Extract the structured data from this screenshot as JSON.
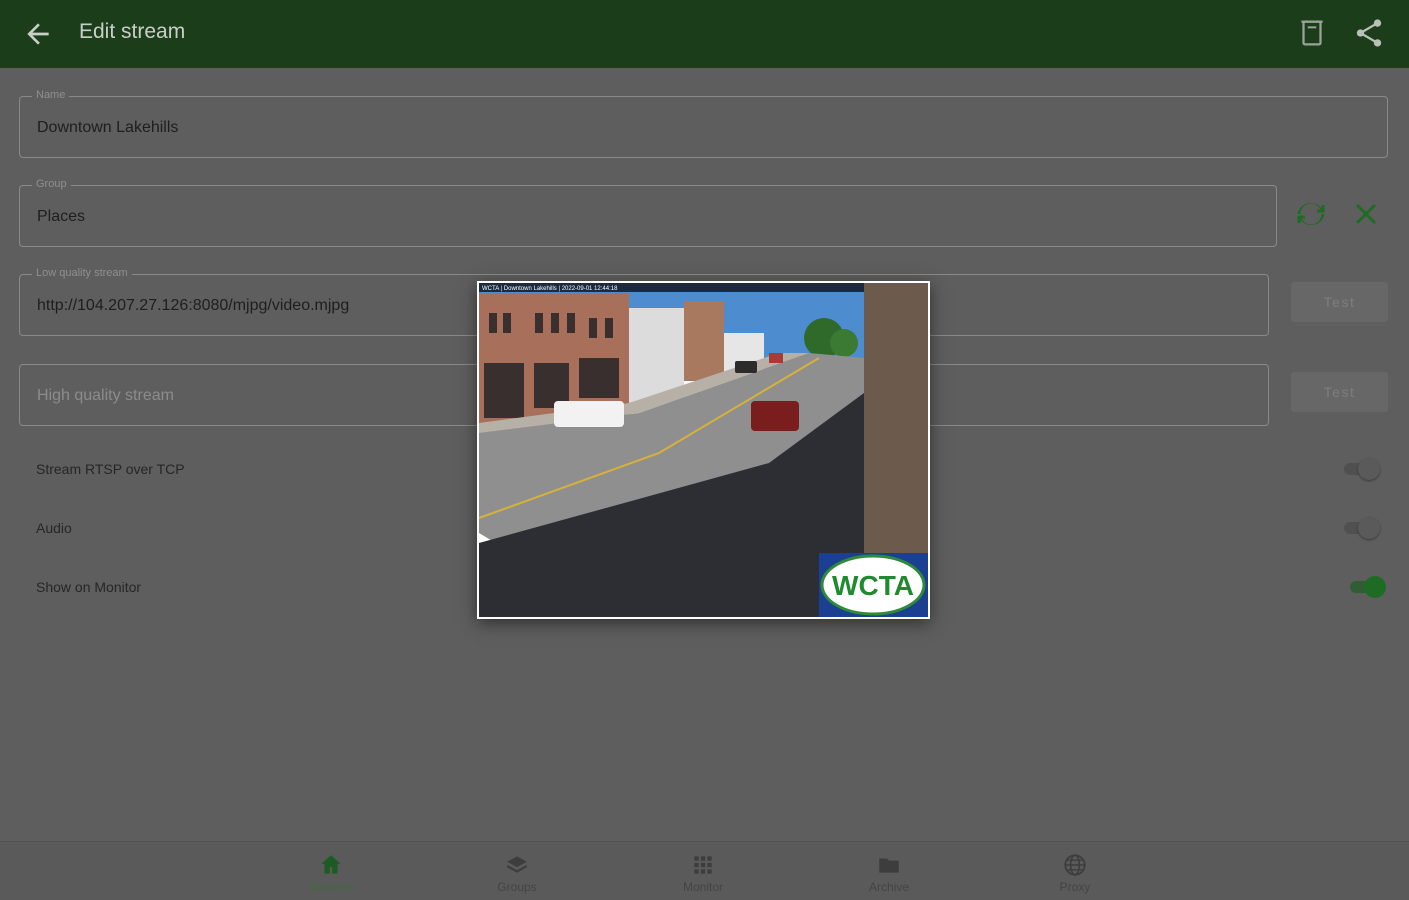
{
  "appbar": {
    "title": "Edit stream",
    "icons": [
      "arrow-back-icon",
      "delete-icon",
      "share-icon"
    ]
  },
  "form": {
    "name": {
      "label": "Name",
      "value": "Downtown Lakehills"
    },
    "group": {
      "label": "Group",
      "value": "Places"
    },
    "low_quality": {
      "label": "Low quality stream",
      "value": "http://104.207.27.126:8080/mjpg/video.mjpg"
    },
    "high_quality": {
      "placeholder": "High quality stream"
    },
    "test_label": "Test"
  },
  "settings": {
    "rtsp_tcp": {
      "label": "Stream RTSP over TCP",
      "on": false
    },
    "audio": {
      "label": "Audio",
      "on": false
    },
    "show_monitor": {
      "label": "Show on Monitor",
      "on": true
    }
  },
  "popup": {
    "logo_text": "WCTA",
    "overlay_text": "WCTA | Downtown Lakehills | 2022-09-01 12:44:18"
  },
  "nav": {
    "items": [
      {
        "label": "Streams",
        "icon": "home-icon",
        "active": true
      },
      {
        "label": "Groups",
        "icon": "layers-icon",
        "active": false
      },
      {
        "label": "Monitor",
        "icon": "grid-icon",
        "active": false
      },
      {
        "label": "Archive",
        "icon": "folder-icon",
        "active": false
      },
      {
        "label": "Proxy",
        "icon": "globe-icon",
        "active": false
      }
    ]
  },
  "colors": {
    "appbar": "#1b3d1a",
    "accent": "#1e6b24"
  }
}
